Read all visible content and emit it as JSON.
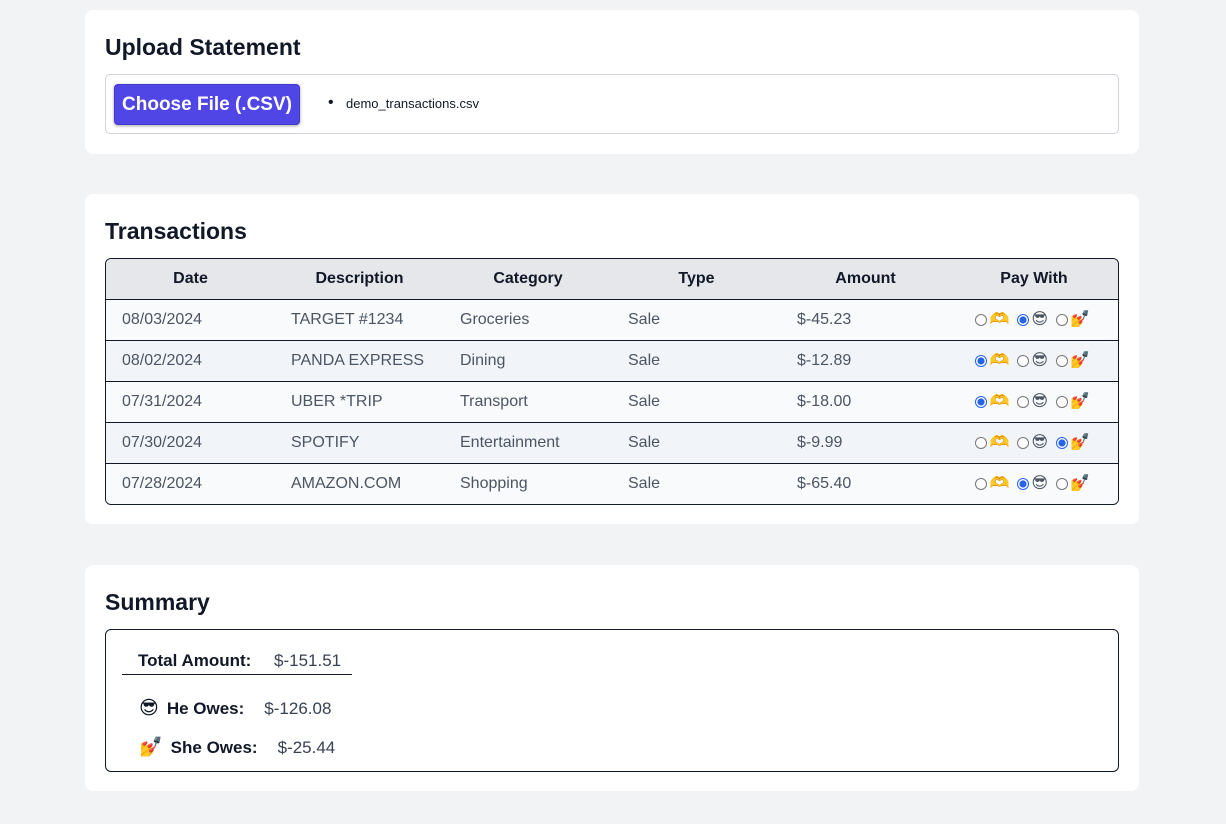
{
  "upload": {
    "title": "Upload Statement",
    "button_label": "Choose File (.CSV)",
    "files": [
      "demo_transactions.csv"
    ]
  },
  "transactions": {
    "title": "Transactions",
    "columns": [
      "Date",
      "Description",
      "Category",
      "Type",
      "Amount",
      "Pay With"
    ],
    "pay_options": [
      "heart-hands",
      "sunglasses-face",
      "nail-polish"
    ],
    "rows": [
      {
        "date": "08/03/2024",
        "description": "TARGET #1234",
        "category": "Groceries",
        "type": "Sale",
        "amount": "$-45.23",
        "pay_with": "sunglasses-face"
      },
      {
        "date": "08/02/2024",
        "description": "PANDA EXPRESS",
        "category": "Dining",
        "type": "Sale",
        "amount": "$-12.89",
        "pay_with": "heart-hands"
      },
      {
        "date": "07/31/2024",
        "description": "UBER *TRIP",
        "category": "Transport",
        "type": "Sale",
        "amount": "$-18.00",
        "pay_with": "heart-hands"
      },
      {
        "date": "07/30/2024",
        "description": "SPOTIFY",
        "category": "Entertainment",
        "type": "Sale",
        "amount": "$-9.99",
        "pay_with": "nail-polish"
      },
      {
        "date": "07/28/2024",
        "description": "AMAZON.COM",
        "category": "Shopping",
        "type": "Sale",
        "amount": "$-65.40",
        "pay_with": "sunglasses-face"
      }
    ]
  },
  "summary": {
    "title": "Summary",
    "total_label": "Total Amount:",
    "total_value": "$-151.51",
    "he_icon": "sunglasses-face",
    "he_label": "He Owes:",
    "he_value": "$-126.08",
    "she_icon": "nail-polish",
    "she_label": "She Owes:",
    "she_value": "$-25.44"
  },
  "colors": {
    "accent": "#4f46e5",
    "radio": "#2563eb",
    "page_bg": "#f2f3f5"
  }
}
